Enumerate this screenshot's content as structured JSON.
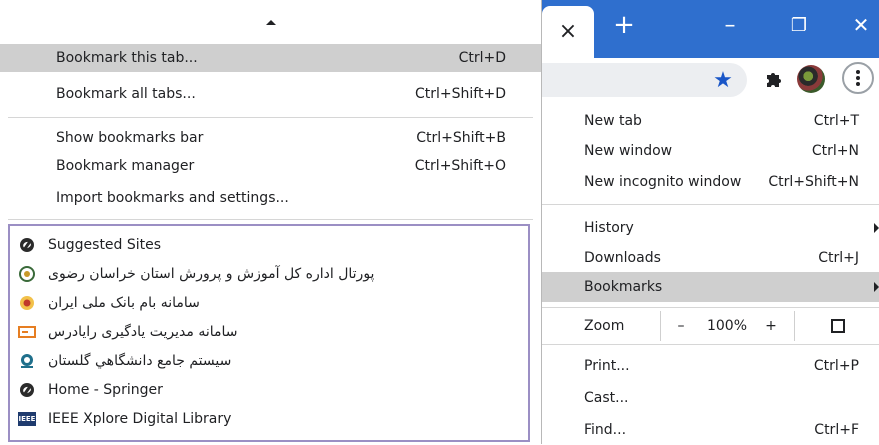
{
  "bookmarks_menu": {
    "items": [
      {
        "label": "Bookmark this tab...",
        "shortcut": "Ctrl+D"
      },
      {
        "label": "Bookmark all tabs...",
        "shortcut": "Ctrl+Shift+D"
      },
      {
        "label": "Show bookmarks bar",
        "shortcut": "Ctrl+Shift+B"
      },
      {
        "label": "Bookmark manager",
        "shortcut": "Ctrl+Shift+O"
      },
      {
        "label": "Import bookmarks and settings...",
        "shortcut": ""
      }
    ],
    "bookmarks": [
      {
        "label": "Suggested Sites",
        "icon": "globe-icon"
      },
      {
        "label": "پورتال اداره کل آموزش و پرورش استان خراسان رضوی",
        "icon": "emblem-icon"
      },
      {
        "label": "سامانه بام بانک ملی ایران",
        "icon": "bank-logo-icon"
      },
      {
        "label": "سامانه مدیریت یادگیری رایادرس",
        "icon": "card-icon"
      },
      {
        "label": "سیستم جامع دانشگاهي گلستان",
        "icon": "university-icon"
      },
      {
        "label": "Home - Springer",
        "icon": "globe-icon"
      },
      {
        "label": "IEEE Xplore Digital Library",
        "icon": "ieee-logo-icon"
      }
    ]
  },
  "window": {
    "tab_close": "×",
    "new_tab": "+",
    "minimize": "–",
    "restore": "❐",
    "close": "✕",
    "star": "★"
  },
  "chrome_menu": {
    "new_tab": {
      "label": "New tab",
      "shortcut": "Ctrl+T"
    },
    "new_window": {
      "label": "New window",
      "shortcut": "Ctrl+N"
    },
    "new_incognito": {
      "label": "New incognito window",
      "shortcut": "Ctrl+Shift+N"
    },
    "history": {
      "label": "History"
    },
    "downloads": {
      "label": "Downloads",
      "shortcut": "Ctrl+J"
    },
    "bookmarks": {
      "label": "Bookmarks"
    },
    "zoom": {
      "label": "Zoom",
      "minus": "–",
      "value": "100%",
      "plus": "+"
    },
    "print": {
      "label": "Print...",
      "shortcut": "Ctrl+P"
    },
    "cast": {
      "label": "Cast..."
    },
    "find": {
      "label": "Find...",
      "shortcut": "Ctrl+F"
    }
  },
  "colors": {
    "tabstrip": "#2f6fce",
    "highlight": "#cfcfcf",
    "list_border": "#9b8fc4"
  }
}
